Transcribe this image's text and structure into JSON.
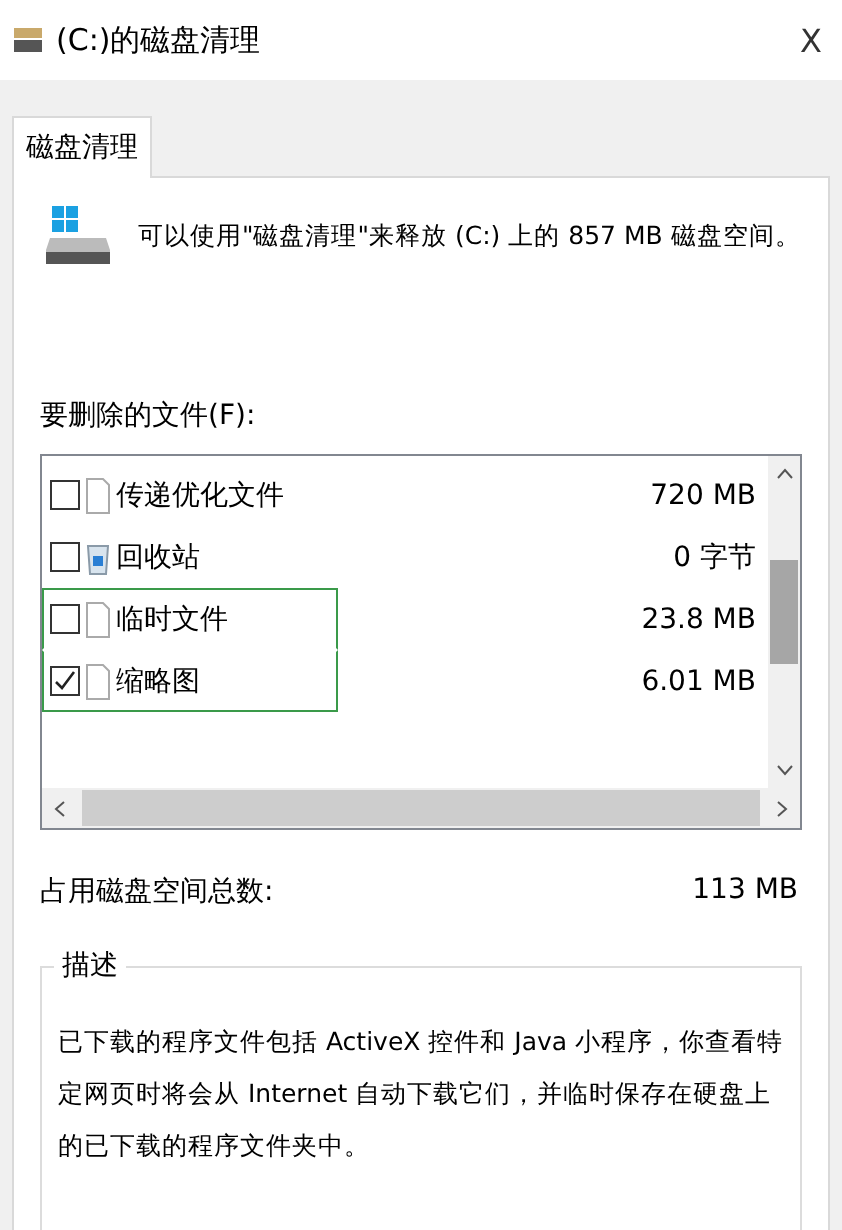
{
  "window": {
    "title": "(C:)的磁盘清理",
    "close": "X"
  },
  "tabs": [
    {
      "label": "磁盘清理",
      "selected": true
    }
  ],
  "header": {
    "text": "可以使用\"磁盘清理\"来释放 (C:) 上的 857 MB 磁盘空间。"
  },
  "files_label": "要删除的文件(F):",
  "files": [
    {
      "name": "传递优化文件",
      "size": "720 MB",
      "checked": false,
      "focused": false,
      "kind": "file"
    },
    {
      "name": "回收站",
      "size": "0 字节",
      "checked": false,
      "focused": false,
      "kind": "recycle"
    },
    {
      "name": "临时文件",
      "size": "23.8 MB",
      "checked": false,
      "focused": true,
      "kind": "file"
    },
    {
      "name": "缩略图",
      "size": "6.01 MB",
      "checked": true,
      "focused": true,
      "kind": "file"
    }
  ],
  "total": {
    "label": "占用磁盘空间总数:",
    "value": "113 MB"
  },
  "description": {
    "title": "描述",
    "text": "已下载的程序文件包括 ActiveX 控件和 Java 小程序，你查看特定网页时将会从 Internet 自动下载它们，并临时保存在硬盘上的已下载的程序文件夹中。"
  }
}
